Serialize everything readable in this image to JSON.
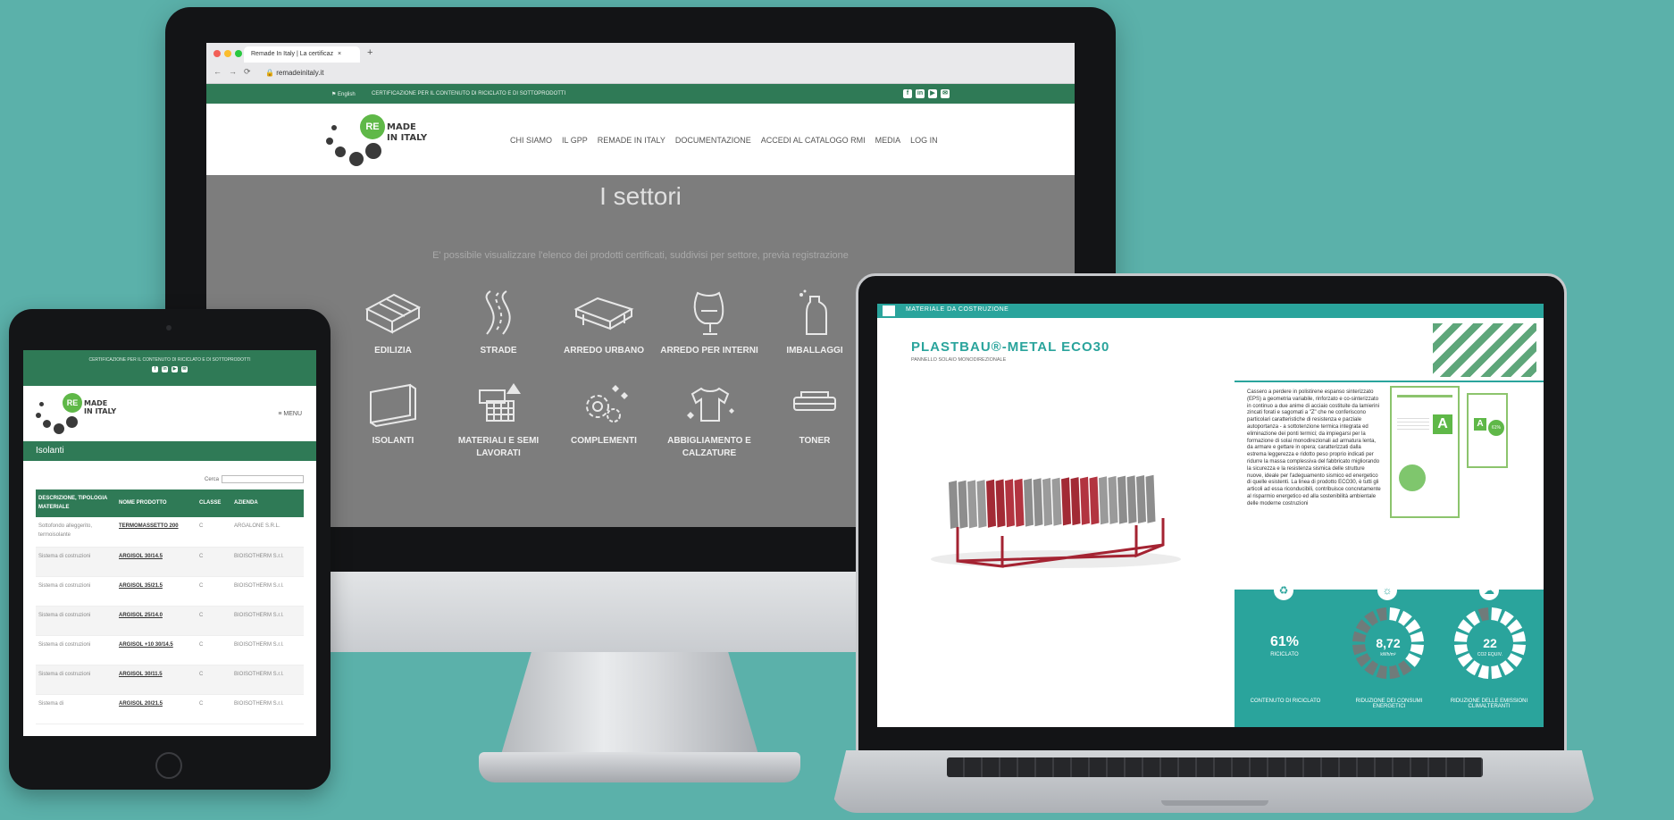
{
  "colors": {
    "background": "#5bb1aa",
    "brand_green": "#2f7a56",
    "logo_green": "#5fb848",
    "teal": "#2aa49c"
  },
  "monitor": {
    "browser": {
      "tab_title": "Remade In Italy | La certificaz",
      "tab_close": "×",
      "new_tab": "+",
      "url": "remadeinitaly.it",
      "nav_glyphs": "←→⟳",
      "lock_icon": "lock-icon"
    },
    "topbar": {
      "language": "⚑ English",
      "certification": "CERTIFICAZIONE PER IL CONTENUTO DI RICICLATO E DI SOTTOPRODOTTI",
      "social": [
        "f",
        "in",
        "▶",
        "✉"
      ]
    },
    "logo": {
      "badge": "RE",
      "line1": "MADE",
      "line2": "IN ITALY"
    },
    "nav": [
      "CHI SIAMO",
      "IL GPP",
      "REMADE IN ITALY",
      "DOCUMENTAZIONE",
      "ACCEDI AL CATALOGO RMI",
      "MEDIA",
      "LOG IN"
    ],
    "title": "I settori",
    "subtitle": "E' possibile visualizzare l'elenco dei prodotti certificati, suddivisi per settore, previa registrazione",
    "sectors": [
      {
        "label": "EDILIZIA",
        "icon": "brick-icon"
      },
      {
        "label": "STRADE",
        "icon": "road-icon"
      },
      {
        "label": "ARREDO URBANO",
        "icon": "bench-icon"
      },
      {
        "label": "ARREDO PER INTERNI",
        "icon": "chair-icon"
      },
      {
        "label": "IMBALLAGGI",
        "icon": "bottle-icon"
      },
      {
        "label": "ISOLANTI",
        "icon": "panel-icon"
      },
      {
        "label": "MATERIALI E SEMI LAVORATI",
        "icon": "materials-icon"
      },
      {
        "label": "COMPLEMENTI",
        "icon": "gears-icon"
      },
      {
        "label": "ABBIGLIAMENTO E CALZATURE",
        "icon": "tshirt-icon"
      },
      {
        "label": "TONER",
        "icon": "toner-icon"
      }
    ]
  },
  "tablet": {
    "topbar": "CERTIFICAZIONE PER IL CONTENUTO DI RICICLATO E DI SOTTOPRODOTTI",
    "menu": "≡ MENU",
    "section": "Isolanti",
    "search_label": "Cerca",
    "table": {
      "headers": [
        "DESCRIZIONE, TIPOLOGIA MATERIALE",
        "NOME PRODOTTO",
        "CLASSE",
        "AZIENDA"
      ],
      "rows": [
        {
          "desc": "Sottofondo alleggerito, termoisolante",
          "prod": "TERMOMASSETTO 200",
          "classe": "C",
          "azienda": "ARGALONE S.R.L."
        },
        {
          "desc": "Sistema di costruzioni",
          "prod": "ARGISOL 30/14.5",
          "classe": "C",
          "azienda": "BIOISOTHERM S.r.l."
        },
        {
          "desc": "Sistema di costruzioni",
          "prod": "ARGISOL 35/21.5",
          "classe": "C",
          "azienda": "BIOISOTHERM S.r.l."
        },
        {
          "desc": "Sistema di costruzioni",
          "prod": "ARGISOL 25/14.0",
          "classe": "C",
          "azienda": "BIOISOTHERM S.r.l."
        },
        {
          "desc": "Sistema di costruzioni",
          "prod": "ARGISOL +10 30/14.5",
          "classe": "C",
          "azienda": "BIOISOTHERM S.r.l."
        },
        {
          "desc": "Sistema di costruzioni",
          "prod": "ARGISOL 30/11.5",
          "classe": "C",
          "azienda": "BIOISOTHERM S.r.l."
        },
        {
          "desc": "Sistema di",
          "prod": "ARGISOL 20/21.5",
          "classe": "C",
          "azienda": "BIOISOTHERM S.r.l."
        }
      ]
    }
  },
  "laptop": {
    "category": "MATERIALE DA COSTRUZIONE",
    "product": "PLASTBAU®-METAL ECO30",
    "product_sub": "PANNELLO SOLAIO MONODIREZIONALE",
    "description": "Cassero a perdere in polistirene espanso sinterizzato (EPS) a geometria variabile, rinforzato e co-sinterizzato in continuo a due anime di acciaio costituite da lamierini zincati forati e sagomati a \"Z\" che ne conferiscono particolari caratteristiche di resistenza e parziale autoportanza - a sottotenzione termica integrata ed eliminazione dei ponti termici; da impiegarsi per la formazione di solai monodirezionali ad armatura lenta, da armare e gettare in opera; caratterizzati dalla estrema leggerezza e ridotto peso proprio indicati per ridurre la massa complessiva del fabbricato migliorando la sicurezza e la resistenza sismica delle strutture nuove, ideale per l'adeguamento sismico ed energetico di quelle esistenti. La linea di prodotto ECO30, è tutti gli articoli ad essa riconducibili, contribuisce concretamente al risparmio energetico ed alla sostenibilità ambientale delle moderne costruzioni",
    "label_grade": "A",
    "label_percent": "61%",
    "stats": [
      {
        "value": "61%",
        "unit": "RICICLATO",
        "label": "CONTENUTO DI RICICLATO",
        "icon": "recycle-icon",
        "fill": 1.0
      },
      {
        "value": "8,72",
        "unit": "kWh/m²",
        "label": "RIDUZIONE DEI CONSUMI ENERGETICI",
        "icon": "bulb-icon",
        "fill": 0.38
      },
      {
        "value": "22",
        "unit": "CO2 EQUIV.",
        "label": "RIDUZIONE DELLE EMISSIONI CLIMALTERANTI",
        "icon": "cloud-icon",
        "fill": 0.92
      }
    ]
  }
}
